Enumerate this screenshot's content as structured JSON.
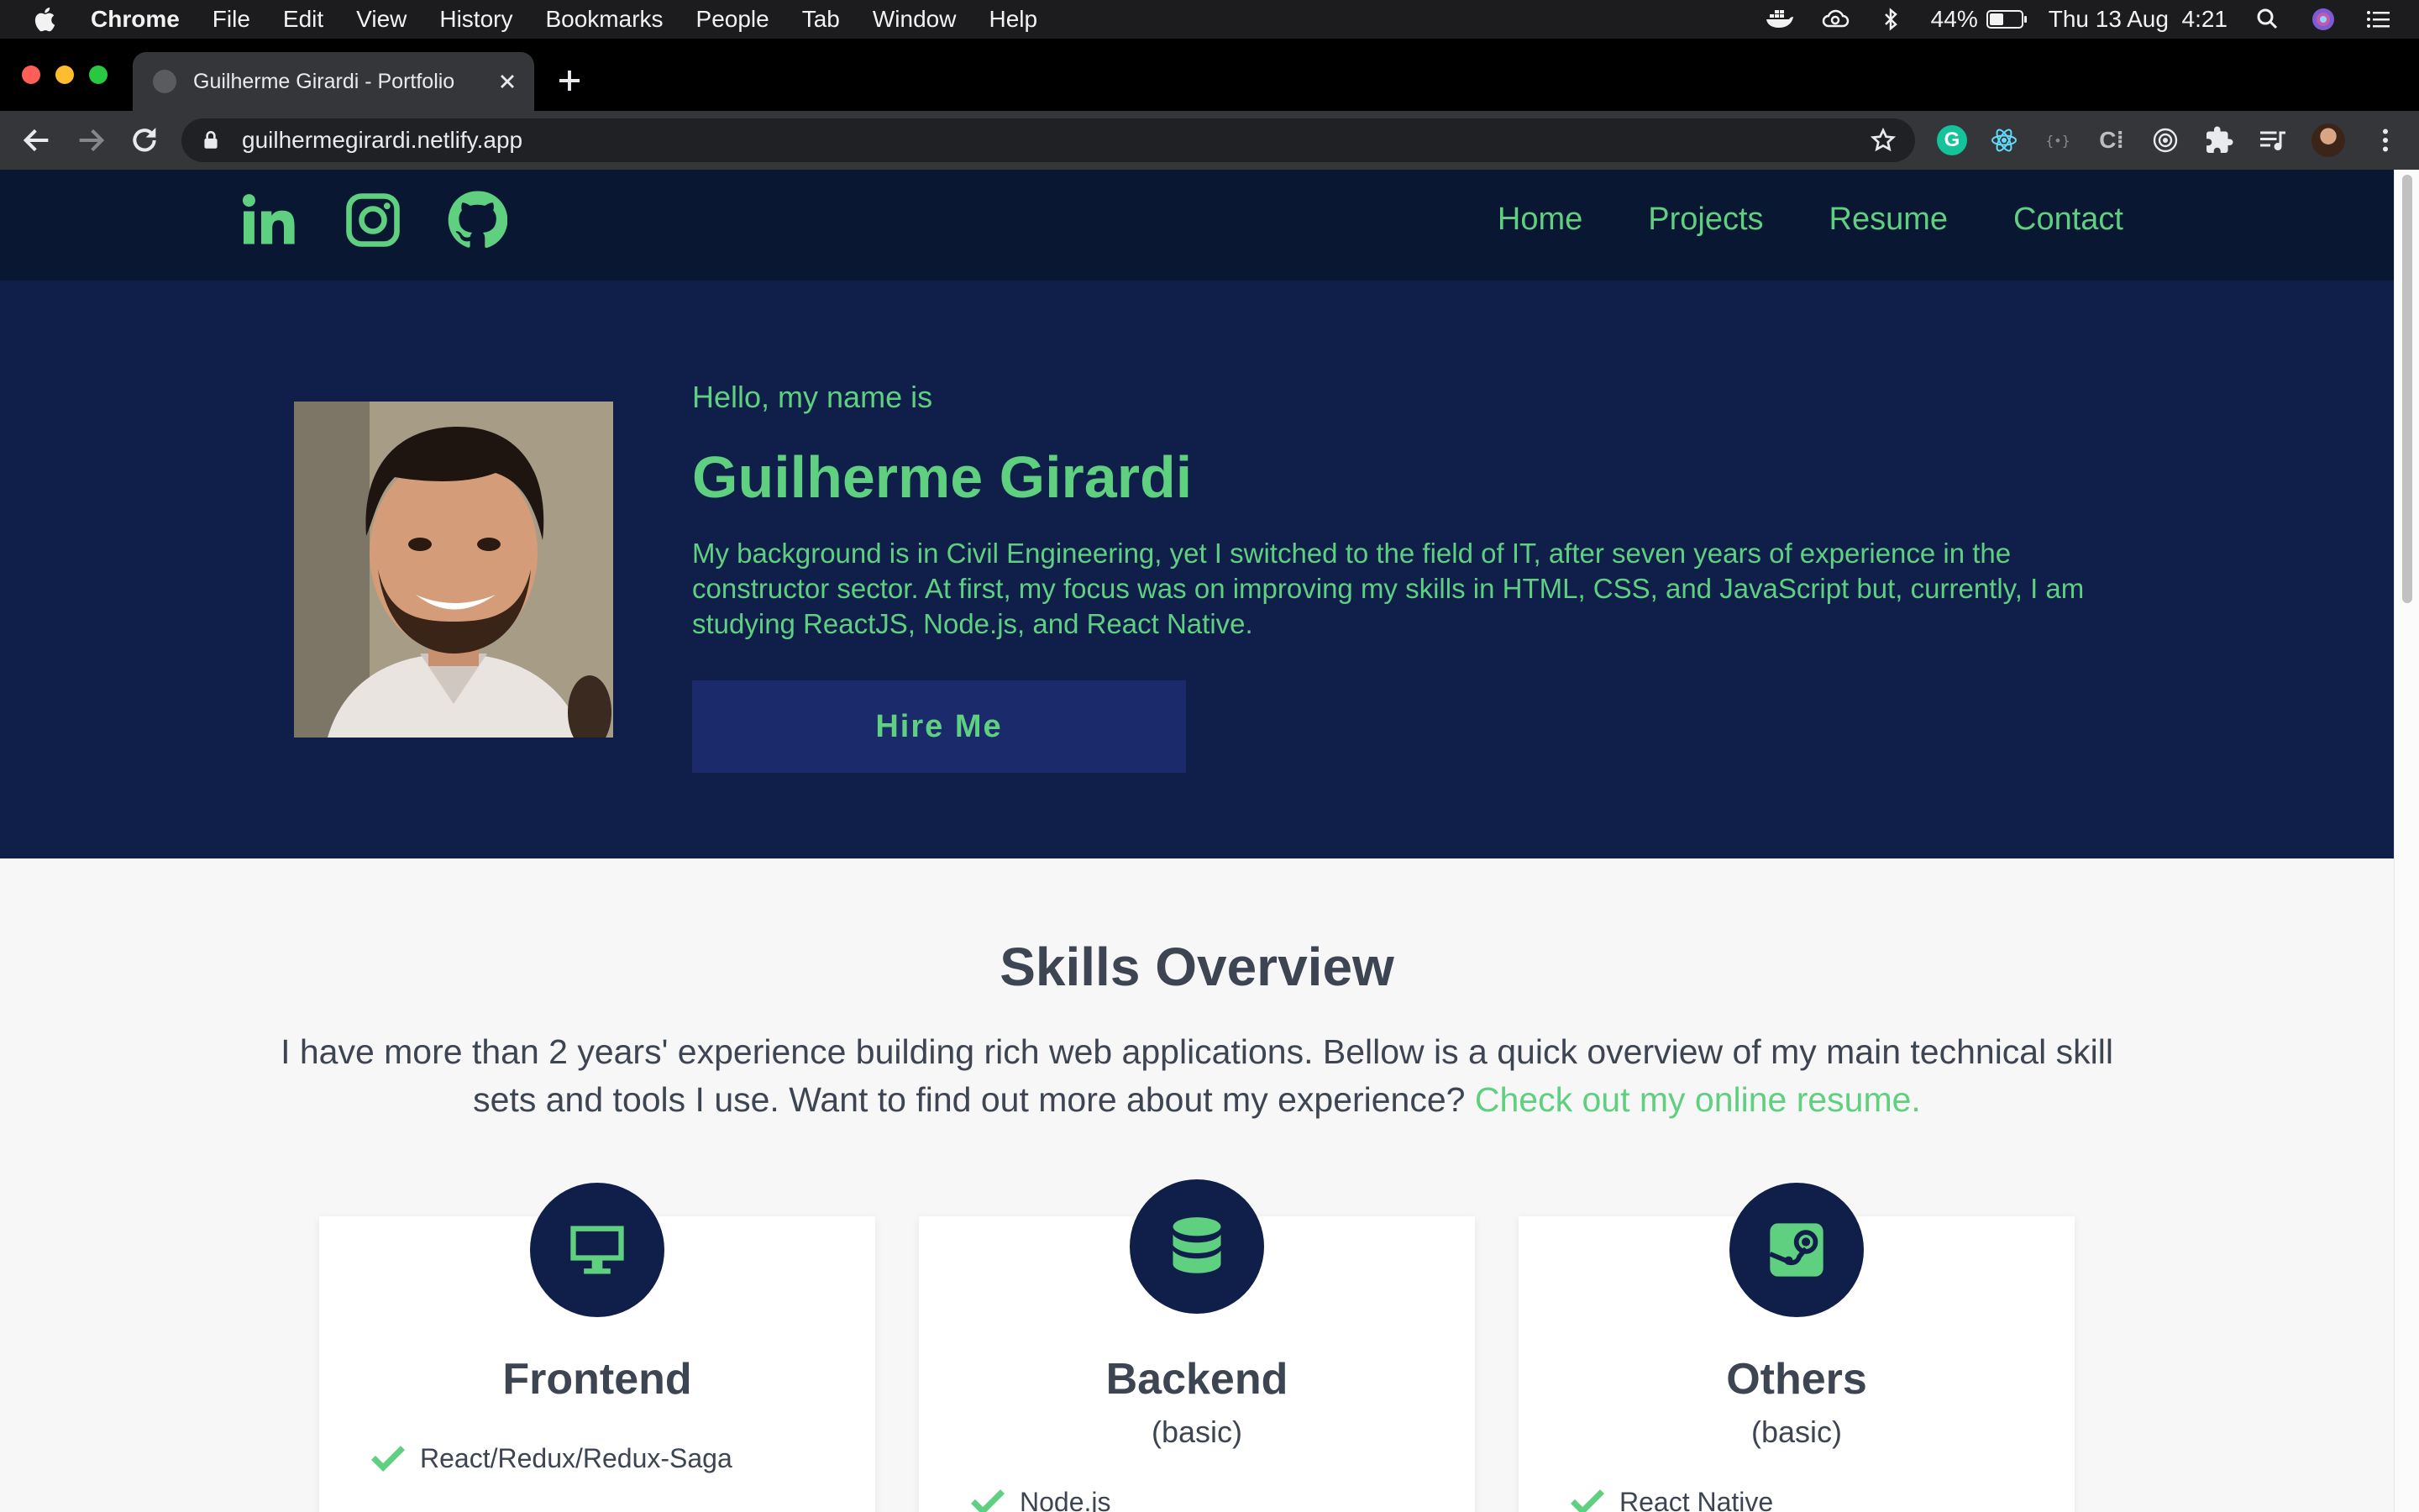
{
  "menubar": {
    "app_name": "Chrome",
    "items": [
      "File",
      "Edit",
      "View",
      "History",
      "Bookmarks",
      "People",
      "Tab",
      "Window",
      "Help"
    ],
    "battery_percent": "44%",
    "battery_level": 0.44,
    "clock": "Thu 13 Aug  4:21"
  },
  "browser": {
    "tab_title": "Guilherme Girardi - Portfolio",
    "url": "guilhermegirardi.netlify.app",
    "extensions": {
      "grammarly": "G",
      "c_ext": "C⁞"
    }
  },
  "site": {
    "nav": {
      "links": [
        "Home",
        "Projects",
        "Resume",
        "Contact"
      ]
    },
    "hero": {
      "greeting": "Hello, my name is",
      "name": "Guilherme Girardi",
      "bio": "My background is in Civil Engineering, yet I switched to the field of IT, after seven years of experience in the constructor sector. At first, my focus was on improving my skills in HTML, CSS, and JavaScript but, currently, I am studying ReactJS, Node.js, and React Native.",
      "cta": "Hire Me"
    },
    "skills": {
      "title": "Skills Overview",
      "intro": "I have more than 2 years' experience building rich web applications. Bellow is a quick overview of my main technical skill sets and tools I use. Want to find out more about my experience? ",
      "intro_link": "Check out my online resume.",
      "cards": [
        {
          "title": "Frontend",
          "subtitle": "",
          "items": [
            "React/Redux/Redux-Saga"
          ]
        },
        {
          "title": "Backend",
          "subtitle": "(basic)",
          "items": [
            "Node.js"
          ]
        },
        {
          "title": "Others",
          "subtitle": "(basic)",
          "items": [
            "React Native"
          ]
        }
      ]
    }
  },
  "colors": {
    "accent": "#5fcf80",
    "navy": "#0f1f4a",
    "nav_bg": "#0a1733",
    "text": "#3d4452"
  },
  "icons": [
    "apple-icon",
    "docker-icon",
    "creative-cloud-icon",
    "bluetooth-icon",
    "battery-icon",
    "spotlight-icon",
    "siri-icon",
    "control-center-icon",
    "linkedin-icon",
    "instagram-icon",
    "github-icon",
    "desktop-icon",
    "database-icon",
    "steam-icon",
    "check-icon"
  ]
}
